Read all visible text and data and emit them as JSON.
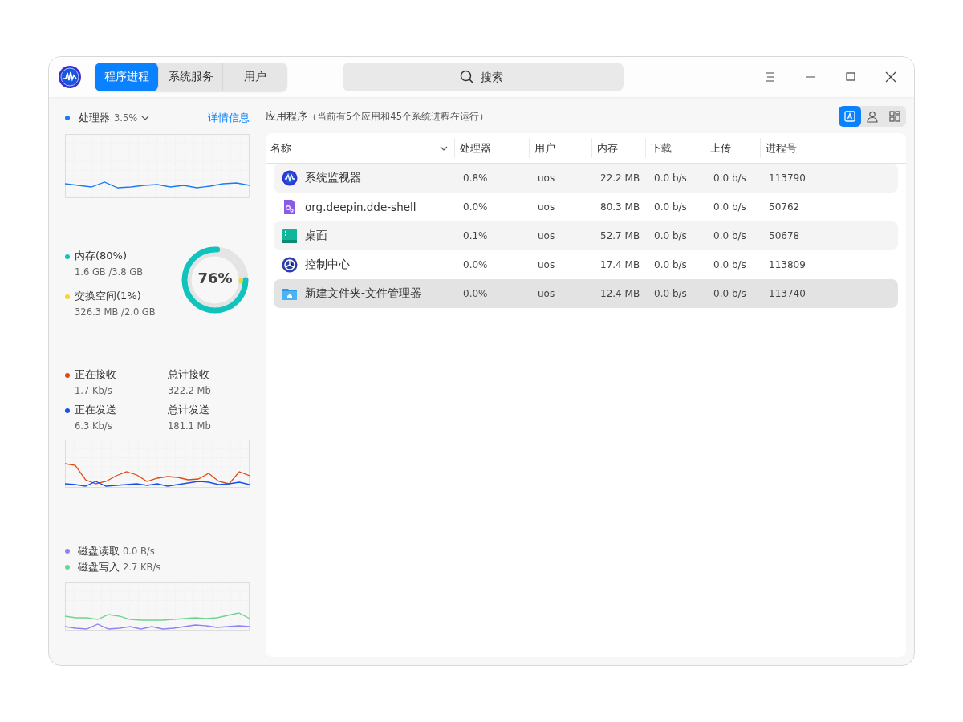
{
  "toolbar": {
    "tabs": [
      {
        "label": "程序进程",
        "selected": true
      },
      {
        "label": "系统服务",
        "selected": false
      },
      {
        "label": "用户",
        "selected": false
      }
    ],
    "search": {
      "placeholder": "搜索"
    }
  },
  "sidebar": {
    "cpu": {
      "label": "处理器",
      "value": "3.5%",
      "link": "详情信息",
      "color": "#1a7cf5"
    },
    "memory": {
      "label": "内存(80%)",
      "detail": "1.6 GB /3.8 GB",
      "color": "#10c3bd",
      "level": 0.76,
      "reading": "76%"
    },
    "swap": {
      "label": "交换空间(1%)",
      "detail": "326.3 MB /2.0 GB",
      "color": "#f8d62a",
      "level": 0.01
    },
    "network": [
      {
        "label": "正在接收",
        "value": "1.7 Kb/s",
        "color": "#e3490f",
        "total_label": "总计接收",
        "total_value": "322.2 Mb"
      },
      {
        "label": "正在发送",
        "value": "6.3 Kb/s",
        "color": "#1650e8",
        "total_label": "总计发送",
        "total_value": "181.1 Mb"
      }
    ],
    "disk": [
      {
        "label": "磁盘读取",
        "value": "0.0 B/s",
        "color": "#8c84f2"
      },
      {
        "label": "磁盘写入",
        "value": "2.7 KB/s",
        "color": "#6cd68c"
      }
    ]
  },
  "content": {
    "heading": "应用程序",
    "note": "（当前有5个应用和45个系统进程在运行）",
    "view_buttons": [
      {
        "selected": true
      },
      {
        "selected": false
      },
      {
        "selected": false
      }
    ],
    "table": {
      "columns": [
        "名称",
        "处理器",
        "用户",
        "内存",
        "下载",
        "上传",
        "进程号"
      ],
      "rows": [
        {
          "name": "系统监视器",
          "cpu": "0.8%",
          "user": "uos",
          "memory": "22.2 MB",
          "download": "0.0 b/s",
          "upload": "0.0 b/s",
          "pid": "113790",
          "selected": false
        },
        {
          "name": "org.deepin.dde-shell",
          "cpu": "0.0%",
          "user": "uos",
          "memory": "80.3 MB",
          "download": "0.0 b/s",
          "upload": "0.0 b/s",
          "pid": "50762",
          "selected": false
        },
        {
          "name": "桌面",
          "cpu": "0.1%",
          "user": "uos",
          "memory": "52.7 MB",
          "download": "0.0 b/s",
          "upload": "0.0 b/s",
          "pid": "50678",
          "selected": false
        },
        {
          "name": "控制中心",
          "cpu": "0.0%",
          "user": "uos",
          "memory": "17.4 MB",
          "download": "0.0 b/s",
          "upload": "0.0 b/s",
          "pid": "113809",
          "selected": false
        },
        {
          "name": "新建文件夹-文件管理器",
          "cpu": "0.0%",
          "user": "uos",
          "memory": "12.4 MB",
          "download": "0.0 b/s",
          "upload": "0.0 b/s",
          "pid": "113740",
          "selected": true
        }
      ]
    }
  }
}
